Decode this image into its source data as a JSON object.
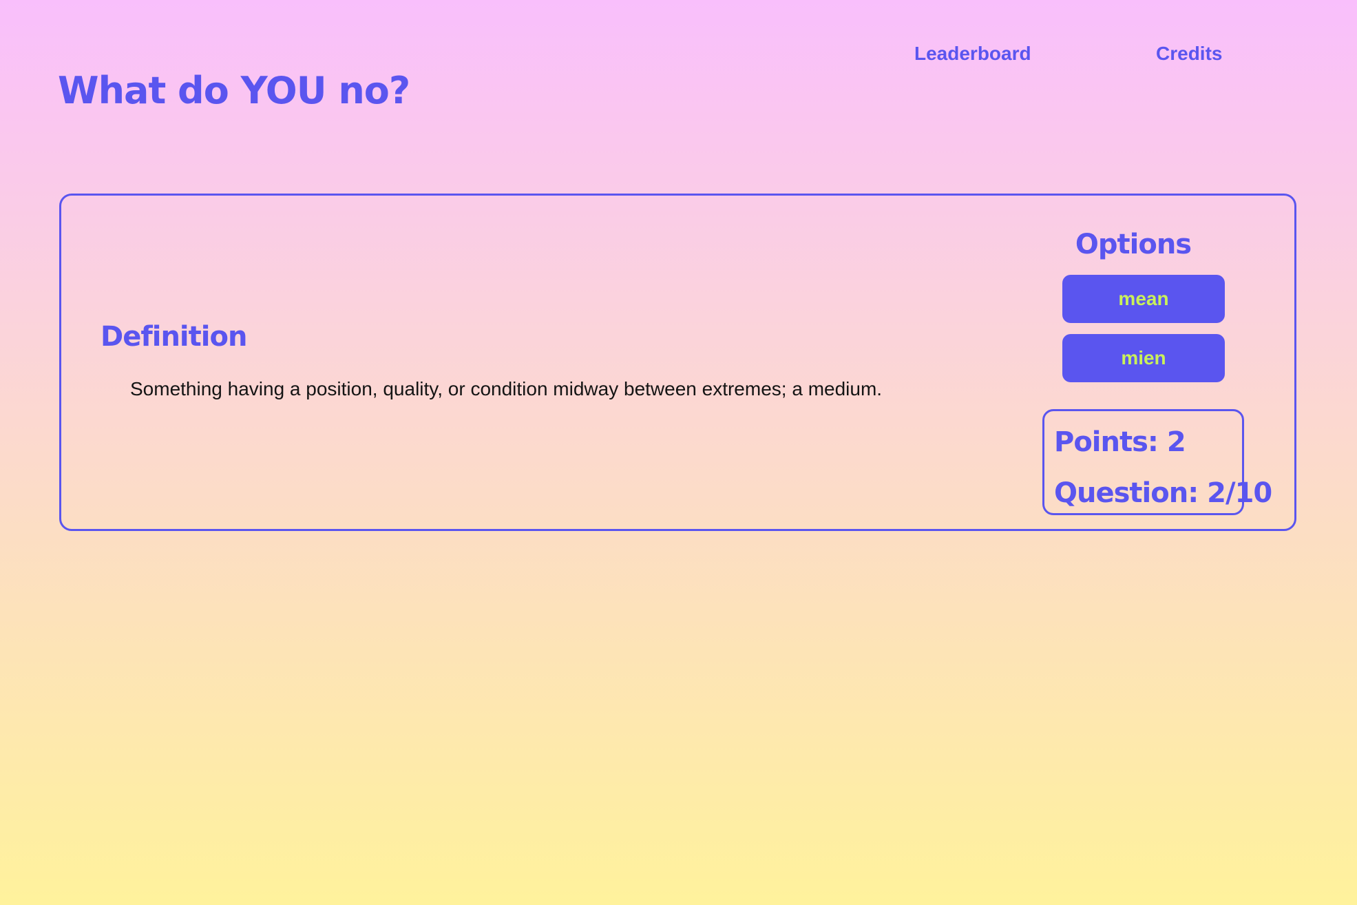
{
  "header": {
    "title": "What do YOU no?",
    "nav": {
      "leaderboard": "Leaderboard",
      "credits": "Credits"
    }
  },
  "definition": {
    "heading": "Definition",
    "text": "Something having a position, quality, or condition midway between extremes; a medium."
  },
  "options": {
    "heading": "Options",
    "choices": [
      "mean",
      "mien"
    ]
  },
  "stats": {
    "points": "Points: 2",
    "question": "Question: 2/10"
  },
  "colors": {
    "accent": "#5a55ef",
    "button_text": "#c9f05a",
    "gradient_top": "#f9bffc",
    "gradient_bottom": "#fff29c"
  }
}
